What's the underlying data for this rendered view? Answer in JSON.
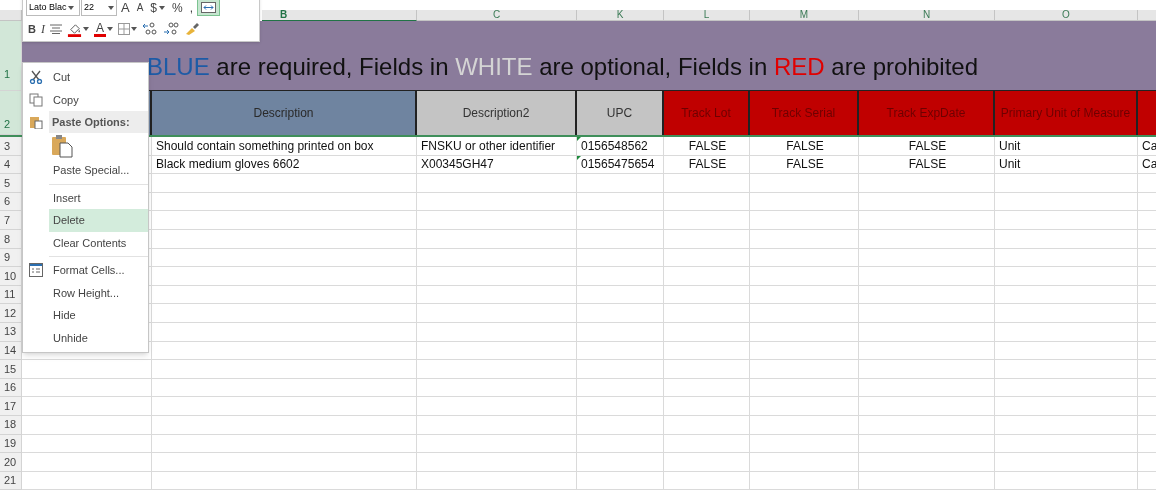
{
  "mini_toolbar": {
    "font": "Lato Blac",
    "size": "22",
    "top_buttons": [
      {
        "kind": "grow",
        "label": "A",
        "selected": false,
        "dropdown": false
      },
      {
        "kind": "shrink",
        "label": "A",
        "selected": false,
        "dropdown": false
      },
      {
        "kind": "text",
        "label": "$",
        "selected": false,
        "dropdown": true
      },
      {
        "kind": "text",
        "label": "%",
        "selected": false,
        "dropdown": false
      },
      {
        "kind": "text",
        "label": ",",
        "selected": false,
        "dropdown": false
      },
      {
        "kind": "merge",
        "selected": true,
        "dropdown": false
      }
    ],
    "bottom_buttons": [
      {
        "kind": "bold",
        "label": "B",
        "dropdown": false
      },
      {
        "kind": "italic",
        "label": "I",
        "dropdown": false
      },
      {
        "kind": "align",
        "dropdown": false
      },
      {
        "kind": "fill",
        "dropdown": true
      },
      {
        "kind": "font-color",
        "label": "A",
        "dropdown": true
      },
      {
        "kind": "borders",
        "dropdown": true
      },
      {
        "kind": "inc-decimal",
        "dropdown": false
      },
      {
        "kind": "dec-decimal",
        "dropdown": false
      },
      {
        "kind": "painter",
        "dropdown": false
      }
    ]
  },
  "sheet": {
    "columns": [
      {
        "kind": "required"
      },
      {
        "letter": "B",
        "header": "Description",
        "kind": "required",
        "selected": true,
        "centered": false
      },
      {
        "letter": "C",
        "header": "Description2",
        "kind": "optional",
        "selected": false,
        "centered": false
      },
      {
        "letter": "K",
        "header": "UPC",
        "kind": "optional",
        "selected": false,
        "centered": false
      },
      {
        "letter": "L",
        "header": "Track Lot",
        "kind": "prohibited",
        "selected": false,
        "centered": true
      },
      {
        "letter": "M",
        "header": "Track Serial",
        "kind": "prohibited",
        "selected": false,
        "centered": true
      },
      {
        "letter": "N",
        "header": "Track ExpDate",
        "kind": "prohibited",
        "selected": false,
        "centered": true
      },
      {
        "letter": "O",
        "header": "Primary Unit of Measure",
        "kind": "prohibited",
        "selected": false,
        "centered": false
      },
      {
        "kind": "prohibited",
        "centered": false
      }
    ],
    "title_row": {
      "number": "1",
      "selected": true,
      "segments": [
        {
          "text": "BLUE",
          "color": "#1d5ba6"
        },
        {
          "text": " are required, Fields in ",
          "color": "#111111"
        },
        {
          "text": "WHITE",
          "color": "#d4d4d4"
        },
        {
          "text": " are optional, Fields in ",
          "color": "#111111"
        },
        {
          "text": "RED",
          "color": "#e00000"
        },
        {
          "text": " are prohibited",
          "color": "#111111"
        }
      ]
    },
    "header_row": {
      "number": "2",
      "selected": true
    },
    "rows": [
      {
        "number": "3",
        "selected": false,
        "cells": [
          null,
          {
            "text": "Should contain something printed on box",
            "flagged": false
          },
          {
            "text": "FNSKU or other identifier",
            "flagged": false
          },
          {
            "text": "0156548562",
            "flagged": true
          },
          {
            "text": "FALSE",
            "flagged": false
          },
          {
            "text": "FALSE",
            "flagged": false
          },
          {
            "text": "FALSE",
            "flagged": false
          },
          {
            "text": "Unit",
            "flagged": false
          },
          {
            "text": "Ca",
            "flagged": false
          }
        ]
      },
      {
        "number": "4",
        "selected": false,
        "cells": [
          null,
          {
            "text": "Black medium gloves 6602",
            "flagged": false
          },
          {
            "text": "X00345GH47",
            "flagged": false
          },
          {
            "text": "01565475654",
            "flagged": true
          },
          {
            "text": "FALSE",
            "flagged": false
          },
          {
            "text": "FALSE",
            "flagged": false
          },
          {
            "text": "FALSE",
            "flagged": false
          },
          {
            "text": "Unit",
            "flagged": false
          },
          {
            "text": "Ca",
            "flagged": false
          }
        ]
      },
      {
        "number": "5",
        "selected": false
      },
      {
        "number": "6",
        "selected": false
      },
      {
        "number": "7",
        "selected": false
      },
      {
        "number": "8",
        "selected": false
      },
      {
        "number": "9",
        "selected": false
      },
      {
        "number": "10",
        "selected": false
      },
      {
        "number": "11",
        "selected": false
      },
      {
        "number": "12",
        "selected": false
      },
      {
        "number": "13",
        "selected": false
      },
      {
        "number": "14",
        "selected": false
      },
      {
        "number": "15",
        "selected": false
      },
      {
        "number": "16",
        "selected": false
      },
      {
        "number": "17",
        "selected": false
      },
      {
        "number": "18",
        "selected": false
      },
      {
        "number": "19",
        "selected": false
      },
      {
        "number": "20",
        "selected": false
      },
      {
        "number": "21",
        "selected": false
      }
    ]
  },
  "context_menu": {
    "items": [
      {
        "kind": "cut",
        "label": "Cut",
        "selected": false
      },
      {
        "kind": "copy",
        "label": "Copy",
        "selected": false
      },
      {
        "kind": "header",
        "label": "Paste Options:"
      },
      {
        "kind": "paste-option"
      },
      {
        "kind": "command",
        "label": "Paste Special...",
        "selected": false
      },
      {
        "kind": "separator"
      },
      {
        "kind": "command",
        "label": "Insert",
        "selected": false
      },
      {
        "kind": "command",
        "label": "Delete",
        "selected": true
      },
      {
        "kind": "command",
        "label": "Clear Contents",
        "selected": false
      },
      {
        "kind": "separator"
      },
      {
        "kind": "format",
        "label": "Format Cells...",
        "selected": false
      },
      {
        "kind": "command",
        "label": "Row Height...",
        "selected": false
      },
      {
        "kind": "command",
        "label": "Hide",
        "selected": false
      },
      {
        "kind": "command",
        "label": "Unhide",
        "selected": false
      }
    ]
  }
}
